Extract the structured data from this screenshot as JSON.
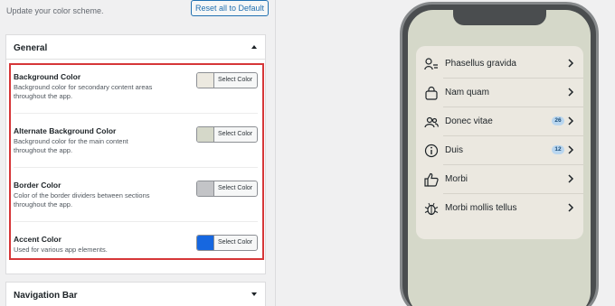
{
  "header": {
    "subtitle": "Update your color scheme.",
    "reset_label": "Reset all to Default"
  },
  "general": {
    "title": "General",
    "options": [
      {
        "label": "Background Color",
        "description": "Background color for secondary content areas throughout the app.",
        "button": "Select Color",
        "color": "#ece9e0"
      },
      {
        "label": "Alternate Background Color",
        "description": "Background color for the main content throughout the app.",
        "button": "Select Color",
        "color": "#d5d8c9"
      },
      {
        "label": "Border Color",
        "description": "Color of the border dividers between sections throughout the app.",
        "button": "Select Color",
        "color": "#c3c4c7"
      },
      {
        "label": "Accent Color",
        "description": "Used for various app elements.",
        "button": "Select Color",
        "color": "#1667e0"
      }
    ]
  },
  "navigation": {
    "title": "Navigation Bar"
  },
  "preview": {
    "items": [
      {
        "label": "Phasellus gravida",
        "icon": "user-list-icon"
      },
      {
        "label": "Nam quam",
        "icon": "bag-icon"
      },
      {
        "label": "Donec vitae",
        "icon": "users-icon",
        "badge": "26"
      },
      {
        "label": "Duis",
        "icon": "info-icon",
        "badge": "12"
      },
      {
        "label": "Morbi",
        "icon": "thumbs-up-icon"
      },
      {
        "label": "Morbi mollis tellus",
        "icon": "bug-icon"
      }
    ]
  }
}
